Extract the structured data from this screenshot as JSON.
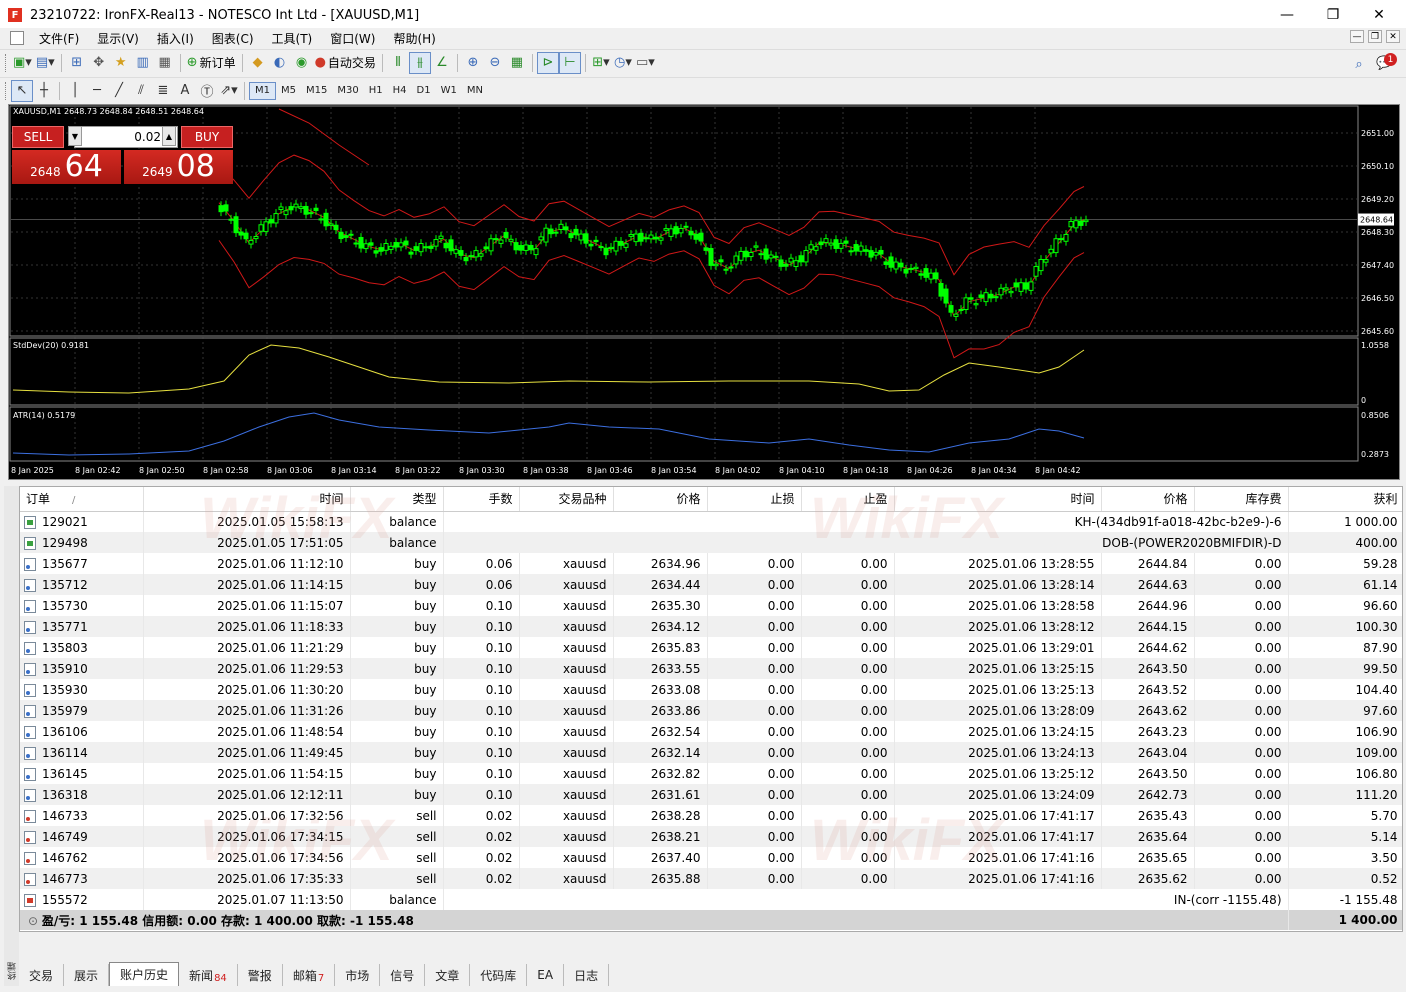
{
  "window": {
    "title": "23210722: IronFX-Real13 - NOTESCO Int Ltd - [XAUUSD,M1]",
    "app_icon": "F",
    "controls": {
      "minimize": "—",
      "maximize": "❐",
      "close": "✕"
    }
  },
  "menu": [
    "文件(F)",
    "显示(V)",
    "插入(I)",
    "图表(C)",
    "工具(T)",
    "窗口(W)",
    "帮助(H)"
  ],
  "toolbar1": {
    "new_order": "新订单",
    "auto_trading": "自动交易",
    "notification_count": "1"
  },
  "toolbar2": {
    "timeframes": [
      "M1",
      "M5",
      "M15",
      "M30",
      "H1",
      "H4",
      "D1",
      "W1",
      "MN"
    ],
    "active_timeframe": "M1"
  },
  "chart": {
    "header": "XAUUSD,M1  2648.73 2648.84 2648.51 2648.64",
    "current_price_label": "2648.64",
    "price_axis": [
      "2651.00",
      "2650.10",
      "2649.20",
      "2648.30",
      "2647.40",
      "2646.50",
      "2645.60"
    ],
    "stddev_label": "StdDev(20) 0.9181",
    "stddev_axis": [
      "1.0558",
      "0"
    ],
    "atr_label": "ATR(14) 0.5179",
    "atr_axis": [
      "0.8506",
      "0.2873"
    ],
    "time_axis": [
      "8 Jan 2025",
      "8 Jan 02:42",
      "8 Jan 02:50",
      "8 Jan 02:58",
      "8 Jan 03:06",
      "8 Jan 03:14",
      "8 Jan 03:22",
      "8 Jan 03:30",
      "8 Jan 03:38",
      "8 Jan 03:46",
      "8 Jan 03:54",
      "8 Jan 04:02",
      "8 Jan 04:10",
      "8 Jan 04:18",
      "8 Jan 04:26",
      "8 Jan 04:34",
      "8 Jan 04:42"
    ],
    "colors": {
      "background": "#000000",
      "bull": "#00ff00",
      "bollinger": "#d01818",
      "stddev": "#e6e040",
      "atr": "#3c6fe0"
    }
  },
  "one_click": {
    "sell_label": "SELL",
    "buy_label": "BUY",
    "lot": "0.02",
    "sell_price_small": "2648",
    "sell_price_big": "64",
    "buy_price_small": "2649",
    "buy_price_big": "08"
  },
  "table": {
    "headers": [
      "订单",
      "时间",
      "类型",
      "手数",
      "交易品种",
      "价格",
      "止损",
      "止盈",
      "时间",
      "价格",
      "库存费",
      "获利"
    ],
    "sort_indicator": "/",
    "rows": [
      {
        "icon": "balance",
        "order": "129021",
        "time": "2025.01.05 15:58:13",
        "type": "balance",
        "comment": "KH-(434db91f-a018-42bc-b2e9-)-6",
        "profit": "1 000.00"
      },
      {
        "icon": "balance",
        "order": "129498",
        "time": "2025.01.05 17:51:05",
        "type": "balance",
        "comment": "DOB-(POWER2020BMIFDIR)-D",
        "profit": "400.00"
      },
      {
        "icon": "buy",
        "order": "135677",
        "time": "2025.01.06 11:12:10",
        "type": "buy",
        "lots": "0.06",
        "symbol": "xauusd",
        "price": "2634.96",
        "sl": "0.00",
        "tp": "0.00",
        "close_time": "2025.01.06 13:28:55",
        "close_price": "2644.84",
        "swap": "0.00",
        "profit": "59.28"
      },
      {
        "icon": "buy",
        "order": "135712",
        "time": "2025.01.06 11:14:15",
        "type": "buy",
        "lots": "0.06",
        "symbol": "xauusd",
        "price": "2634.44",
        "sl": "0.00",
        "tp": "0.00",
        "close_time": "2025.01.06 13:28:14",
        "close_price": "2644.63",
        "swap": "0.00",
        "profit": "61.14"
      },
      {
        "icon": "buy",
        "order": "135730",
        "time": "2025.01.06 11:15:07",
        "type": "buy",
        "lots": "0.10",
        "symbol": "xauusd",
        "price": "2635.30",
        "sl": "0.00",
        "tp": "0.00",
        "close_time": "2025.01.06 13:28:58",
        "close_price": "2644.96",
        "swap": "0.00",
        "profit": "96.60"
      },
      {
        "icon": "buy",
        "order": "135771",
        "time": "2025.01.06 11:18:33",
        "type": "buy",
        "lots": "0.10",
        "symbol": "xauusd",
        "price": "2634.12",
        "sl": "0.00",
        "tp": "0.00",
        "close_time": "2025.01.06 13:28:12",
        "close_price": "2644.15",
        "swap": "0.00",
        "profit": "100.30"
      },
      {
        "icon": "buy",
        "order": "135803",
        "time": "2025.01.06 11:21:29",
        "type": "buy",
        "lots": "0.10",
        "symbol": "xauusd",
        "price": "2635.83",
        "sl": "0.00",
        "tp": "0.00",
        "close_time": "2025.01.06 13:29:01",
        "close_price": "2644.62",
        "swap": "0.00",
        "profit": "87.90"
      },
      {
        "icon": "buy",
        "order": "135910",
        "time": "2025.01.06 11:29:53",
        "type": "buy",
        "lots": "0.10",
        "symbol": "xauusd",
        "price": "2633.55",
        "sl": "0.00",
        "tp": "0.00",
        "close_time": "2025.01.06 13:25:15",
        "close_price": "2643.50",
        "swap": "0.00",
        "profit": "99.50"
      },
      {
        "icon": "buy",
        "order": "135930",
        "time": "2025.01.06 11:30:20",
        "type": "buy",
        "lots": "0.10",
        "symbol": "xauusd",
        "price": "2633.08",
        "sl": "0.00",
        "tp": "0.00",
        "close_time": "2025.01.06 13:25:13",
        "close_price": "2643.52",
        "swap": "0.00",
        "profit": "104.40"
      },
      {
        "icon": "buy",
        "order": "135979",
        "time": "2025.01.06 11:31:26",
        "type": "buy",
        "lots": "0.10",
        "symbol": "xauusd",
        "price": "2633.86",
        "sl": "0.00",
        "tp": "0.00",
        "close_time": "2025.01.06 13:28:09",
        "close_price": "2643.62",
        "swap": "0.00",
        "profit": "97.60"
      },
      {
        "icon": "buy",
        "order": "136106",
        "time": "2025.01.06 11:48:54",
        "type": "buy",
        "lots": "0.10",
        "symbol": "xauusd",
        "price": "2632.54",
        "sl": "0.00",
        "tp": "0.00",
        "close_time": "2025.01.06 13:24:15",
        "close_price": "2643.23",
        "swap": "0.00",
        "profit": "106.90"
      },
      {
        "icon": "buy",
        "order": "136114",
        "time": "2025.01.06 11:49:45",
        "type": "buy",
        "lots": "0.10",
        "symbol": "xauusd",
        "price": "2632.14",
        "sl": "0.00",
        "tp": "0.00",
        "close_time": "2025.01.06 13:24:13",
        "close_price": "2643.04",
        "swap": "0.00",
        "profit": "109.00"
      },
      {
        "icon": "buy",
        "order": "136145",
        "time": "2025.01.06 11:54:15",
        "type": "buy",
        "lots": "0.10",
        "symbol": "xauusd",
        "price": "2632.82",
        "sl": "0.00",
        "tp": "0.00",
        "close_time": "2025.01.06 13:25:12",
        "close_price": "2643.50",
        "swap": "0.00",
        "profit": "106.80"
      },
      {
        "icon": "buy",
        "order": "136318",
        "time": "2025.01.06 12:12:11",
        "type": "buy",
        "lots": "0.10",
        "symbol": "xauusd",
        "price": "2631.61",
        "sl": "0.00",
        "tp": "0.00",
        "close_time": "2025.01.06 13:24:09",
        "close_price": "2642.73",
        "swap": "0.00",
        "profit": "111.20"
      },
      {
        "icon": "sell",
        "order": "146733",
        "time": "2025.01.06 17:32:56",
        "type": "sell",
        "lots": "0.02",
        "symbol": "xauusd",
        "price": "2638.28",
        "sl": "0.00",
        "tp": "0.00",
        "close_time": "2025.01.06 17:41:17",
        "close_price": "2635.43",
        "swap": "0.00",
        "profit": "5.70"
      },
      {
        "icon": "sell",
        "order": "146749",
        "time": "2025.01.06 17:34:15",
        "type": "sell",
        "lots": "0.02",
        "symbol": "xauusd",
        "price": "2638.21",
        "sl": "0.00",
        "tp": "0.00",
        "close_time": "2025.01.06 17:41:17",
        "close_price": "2635.64",
        "swap": "0.00",
        "profit": "5.14"
      },
      {
        "icon": "sell",
        "order": "146762",
        "time": "2025.01.06 17:34:56",
        "type": "sell",
        "lots": "0.02",
        "symbol": "xauusd",
        "price": "2637.40",
        "sl": "0.00",
        "tp": "0.00",
        "close_time": "2025.01.06 17:41:16",
        "close_price": "2635.65",
        "swap": "0.00",
        "profit": "3.50"
      },
      {
        "icon": "sell",
        "order": "146773",
        "time": "2025.01.06 17:35:33",
        "type": "sell",
        "lots": "0.02",
        "symbol": "xauusd",
        "price": "2635.88",
        "sl": "0.00",
        "tp": "0.00",
        "close_time": "2025.01.06 17:41:16",
        "close_price": "2635.62",
        "swap": "0.00",
        "profit": "0.52"
      },
      {
        "icon": "balance-neg",
        "order": "155572",
        "time": "2025.01.07 11:13:50",
        "type": "balance",
        "comment": "IN-(corr -1155.48)",
        "profit": "-1 155.48"
      }
    ],
    "summary": {
      "text": "盈/亏: 1 155.48  信用额: 0.00  存款: 1 400.00  取款: -1 155.48",
      "total": "1 400.00"
    }
  },
  "terminal_side_label": "终端",
  "tabs": [
    {
      "label": "交易"
    },
    {
      "label": "展示"
    },
    {
      "label": "账户历史",
      "active": true
    },
    {
      "label": "新闻",
      "badge": "84"
    },
    {
      "label": "警报"
    },
    {
      "label": "邮箱",
      "badge": "7"
    },
    {
      "label": "市场"
    },
    {
      "label": "信号"
    },
    {
      "label": "文章"
    },
    {
      "label": "代码库"
    },
    {
      "label": "EA"
    },
    {
      "label": "日志"
    }
  ],
  "watermark": "WikiFX"
}
